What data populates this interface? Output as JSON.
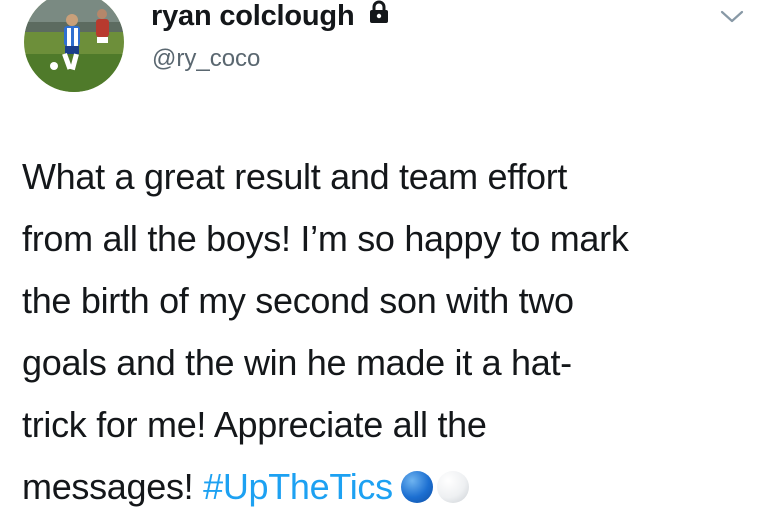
{
  "author": {
    "display_name": "ryan colclough",
    "handle": "@ry_coco",
    "avatar_icon": "player-photo-avatar",
    "protected_icon": "lock-icon"
  },
  "menu": {
    "icon": "chevron-down-icon"
  },
  "tweet": {
    "lines": [
      "What a great result and team effort",
      "from all the boys! I’m so happy to mark",
      "the birth of my second son with two",
      "goals and the win he made it a hat-",
      "trick for me! Appreciate all the"
    ],
    "last_line_text": "messages! ",
    "hashtag": "#UpTheTics",
    "emojis": [
      "blue-circle-emoji",
      "white-circle-emoji"
    ]
  },
  "colors": {
    "hashtag": "#1da1f2",
    "handle": "#5a6770",
    "text": "#14171a"
  }
}
